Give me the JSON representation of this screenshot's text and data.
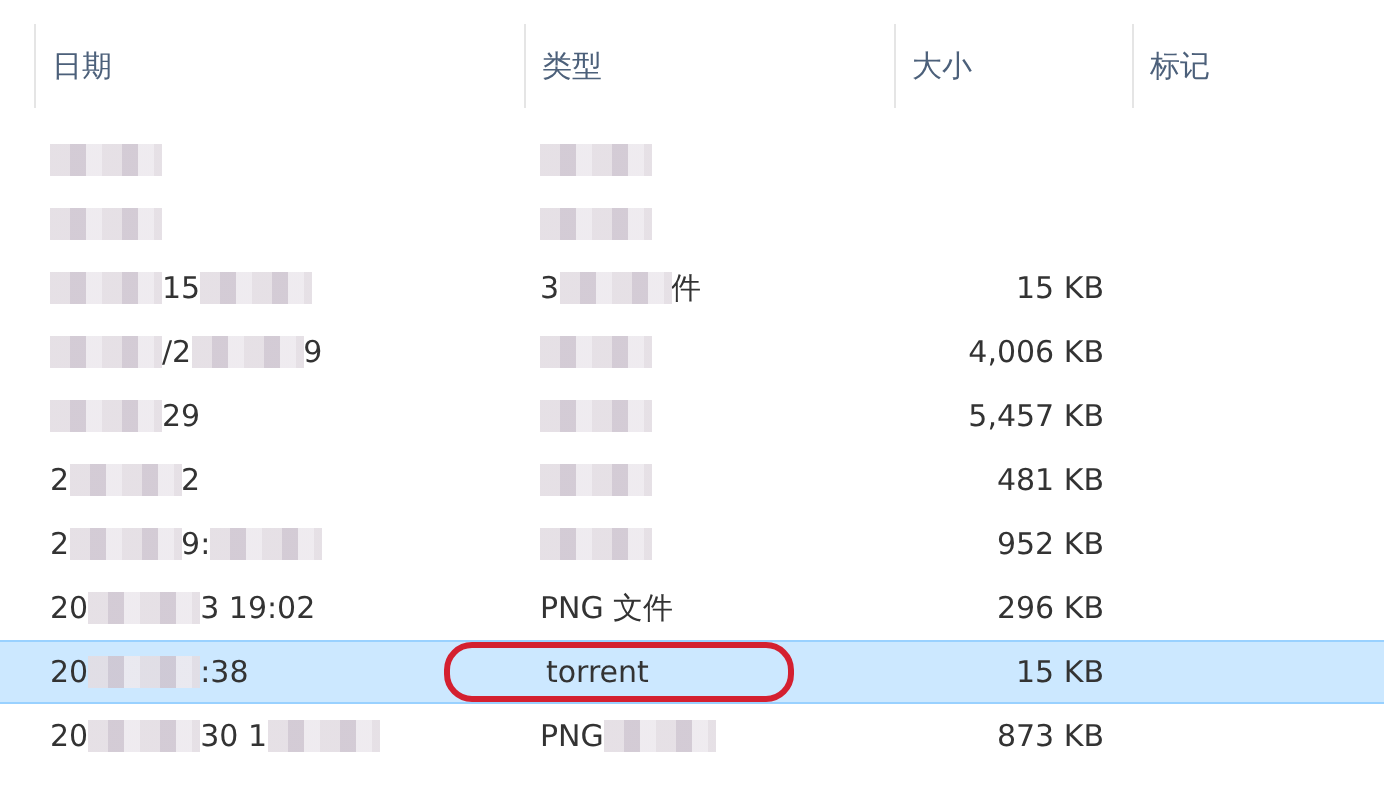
{
  "columns": [
    "日期",
    "类型",
    "大小",
    "标记"
  ],
  "rows": [
    {
      "selected": false,
      "date": [
        {
          "kind": "blur"
        }
      ],
      "type": [
        {
          "kind": "blur"
        }
      ]
    },
    {
      "selected": false,
      "date": [
        {
          "kind": "blur"
        }
      ],
      "type": [
        {
          "kind": "blur"
        }
      ]
    },
    {
      "selected": false,
      "date": [
        {
          "kind": "blur"
        },
        {
          "kind": "text",
          "text": "15"
        },
        {
          "kind": "blur"
        }
      ],
      "type": [
        {
          "kind": "text",
          "text": "3"
        },
        {
          "kind": "blur"
        },
        {
          "kind": "text",
          "text": "件"
        }
      ],
      "size": "15 KB"
    },
    {
      "selected": false,
      "date": [
        {
          "kind": "blur"
        },
        {
          "kind": "text",
          "text": "/2"
        },
        {
          "kind": "blur"
        },
        {
          "kind": "text",
          "text": "9"
        }
      ],
      "type": [
        {
          "kind": "blur"
        }
      ],
      "size": "4,006 KB"
    },
    {
      "selected": false,
      "date": [
        {
          "kind": "blur"
        },
        {
          "kind": "text",
          "text": "29"
        }
      ],
      "type": [
        {
          "kind": "blur"
        }
      ],
      "size": "5,457 KB"
    },
    {
      "selected": false,
      "date": [
        {
          "kind": "text",
          "text": "2"
        },
        {
          "kind": "blur"
        },
        {
          "kind": "text",
          "text": "2"
        }
      ],
      "type": [
        {
          "kind": "blur"
        }
      ],
      "size": "481 KB"
    },
    {
      "selected": false,
      "date": [
        {
          "kind": "text",
          "text": "2"
        },
        {
          "kind": "blur"
        },
        {
          "kind": "text",
          "text": "9:"
        },
        {
          "kind": "blur"
        }
      ],
      "type": [
        {
          "kind": "blur"
        }
      ],
      "size": "952 KB"
    },
    {
      "selected": false,
      "date": [
        {
          "kind": "text",
          "text": "20"
        },
        {
          "kind": "blur"
        },
        {
          "kind": "text",
          "text": "3 19:02"
        }
      ],
      "type": [
        {
          "kind": "text",
          "text": "PNG 文件"
        }
      ],
      "size": "296 KB"
    },
    {
      "selected": true,
      "circled": true,
      "date": [
        {
          "kind": "text",
          "text": "20"
        },
        {
          "kind": "blur"
        },
        {
          "kind": "text",
          "text": ":38"
        }
      ],
      "type": [
        {
          "kind": "text",
          "text": "torrent"
        }
      ],
      "size": "15 KB"
    },
    {
      "selected": false,
      "date": [
        {
          "kind": "text",
          "text": "20"
        },
        {
          "kind": "blur"
        },
        {
          "kind": "text",
          "text": "30 1"
        },
        {
          "kind": "blur"
        }
      ],
      "type": [
        {
          "kind": "text",
          "text": "PNG"
        },
        {
          "kind": "blur"
        }
      ],
      "size": "873 KB"
    }
  ]
}
